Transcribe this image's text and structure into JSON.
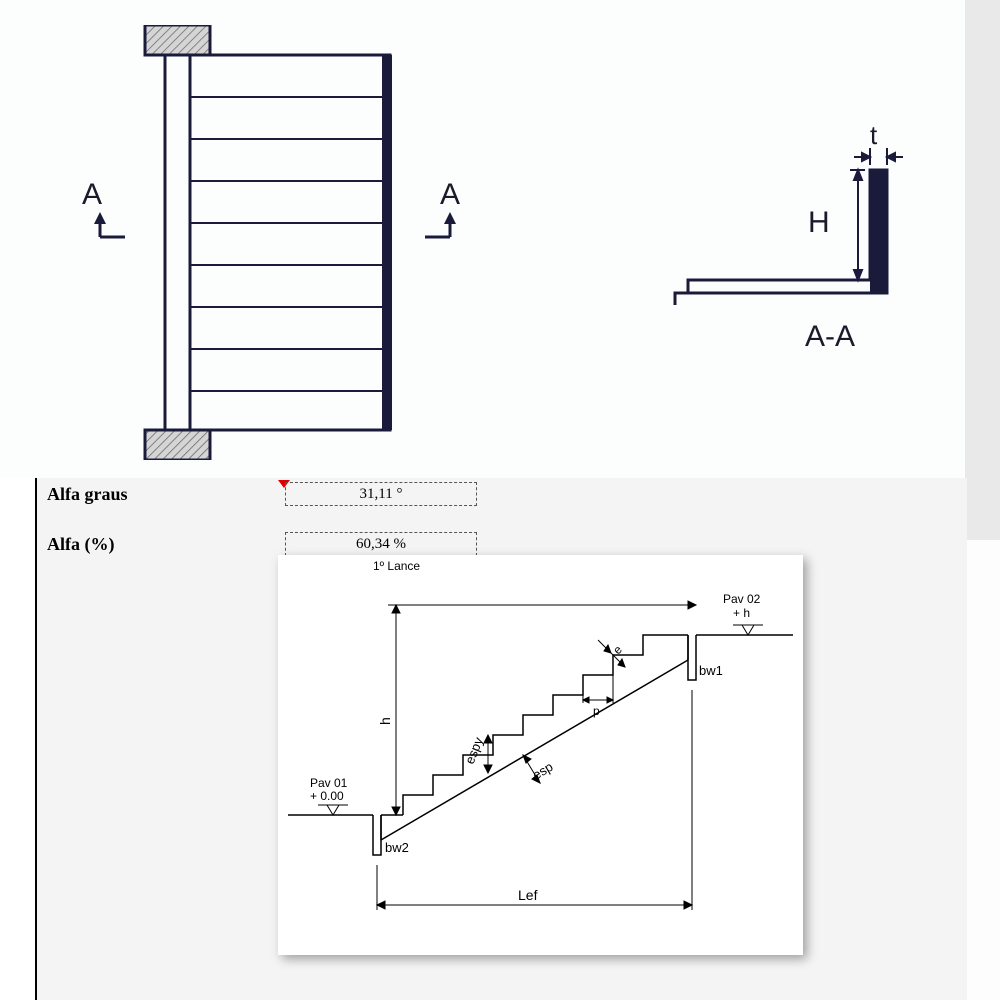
{
  "top_diagram": {
    "left_label": "A",
    "right_label": "A",
    "section_label": "A-A",
    "dim_t": "t",
    "dim_H": "H"
  },
  "fields": {
    "row1_label": "Alfa graus",
    "row1_value": "31,11 °",
    "row2_label": "Alfa (%)",
    "row2_value": "60,34 %"
  },
  "cross_section": {
    "title": "1º Lance",
    "pav01_label": "Pav 01",
    "pav01_level": "+ 0.00",
    "pav02_label": "Pav 02",
    "pav02_level": "+ h",
    "bw1": "bw1",
    "bw2": "bw2",
    "lef": "Lef",
    "h": "h",
    "esp": "esp",
    "espy": "espy",
    "e": "e",
    "p": "p"
  }
}
